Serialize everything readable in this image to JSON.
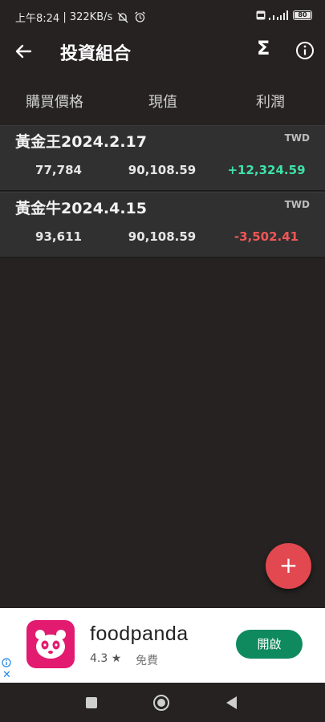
{
  "status": {
    "time": "上午8:24",
    "speed": "322KB/s",
    "battery": "80"
  },
  "appbar": {
    "title": "投資組合",
    "back_icon": "arrow-left-icon",
    "sum_icon": "sigma-icon",
    "sum_symbol": "Σ",
    "info_icon": "info-icon"
  },
  "columns": [
    "購買價格",
    "現值",
    "利潤"
  ],
  "holdings": [
    {
      "name": "黃金王2024.2.17",
      "currency": "TWD",
      "purchase": "77,784",
      "value": "90,108.59",
      "profit": "+12,324.59",
      "profit_color": "#3fe1a7"
    },
    {
      "name": "黃金牛2024.4.15",
      "currency": "TWD",
      "purchase": "93,611",
      "value": "90,108.59",
      "profit": "-3,502.41",
      "profit_color": "#f05656"
    }
  ],
  "fab": {
    "symbol": "+",
    "color": "#e1484f"
  },
  "ad": {
    "app_name": "foodpanda",
    "rating": "4.3 ★",
    "price": "免費",
    "button": "開啟",
    "brand_color": "#e21b70",
    "button_color": "#0f8a5f",
    "close_symbol": "✕"
  }
}
